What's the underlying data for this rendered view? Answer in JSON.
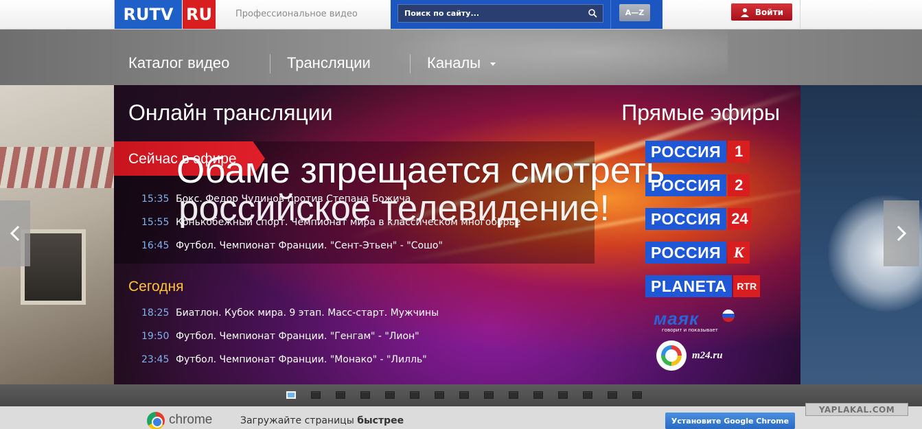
{
  "header": {
    "logo_rutv": "RUTV",
    "logo_ru": "RU",
    "tagline": "Профессиональное видео",
    "search_placeholder": "Поиск по сайту...",
    "az_label": "A—Z",
    "login_label": "Войти"
  },
  "nav": {
    "items": [
      "Каталог видео",
      "Трансляции",
      "Каналы"
    ]
  },
  "hero": {
    "title": "Онлайн трансляции",
    "live_title": "Прямые эфиры",
    "now_label": "Сейчас в эфире",
    "today_label": "Сегодня",
    "now_items": [
      {
        "time": "15:35",
        "title": "Бокс. Федор Чудинов против Степана Божича"
      },
      {
        "time": "15:55",
        "title": "Конькобежный спорт. Чемпионат мира в классическом многоборье"
      },
      {
        "time": "16:45",
        "title": "Футбол. Чемпионат Франции. \"Сент-Этьен\" - \"Сошо\""
      }
    ],
    "today_items": [
      {
        "time": "18:25",
        "title": "Биатлон. Кубок мира. 9 этап. Масс-старт. Мужчины"
      },
      {
        "time": "19:50",
        "title": "Футбол. Чемпионат Франции. \"Генгам\" - \"Лион\""
      },
      {
        "time": "23:45",
        "title": "Футбол. Чемпионат Франции. \"Монако\" - \"Лилль\""
      }
    ],
    "channels": [
      {
        "name": "РОССИЯ",
        "badge": "1"
      },
      {
        "name": "РОССИЯ",
        "badge": "2"
      },
      {
        "name": "РОССИЯ",
        "badge": "24"
      },
      {
        "name": "РОССИЯ",
        "badge": "К"
      },
      {
        "name": "PLANETA",
        "badge": "RTR"
      }
    ],
    "mayak_name": "маяк",
    "mayak_sub": "говорит и показывает",
    "m24_label": "m24.ru"
  },
  "overlay": {
    "line1": "Обаме зпрещается смотреть",
    "line2": "российское телевидение!"
  },
  "slider": {
    "dot_count": 15,
    "active_index": 0
  },
  "chrome_bar": {
    "brand": "chrome",
    "promo_text": "Загружайте страницы",
    "promo_bold": "быстрее",
    "install_label": "Установите Google Chrome"
  },
  "watermark": "YAPLAKAL.COM",
  "colors": {
    "brand_blue": "#1f5fc8",
    "brand_red": "#d81e1e",
    "time_blue": "#7fb2ee",
    "today_yellow": "#ffc23a"
  }
}
